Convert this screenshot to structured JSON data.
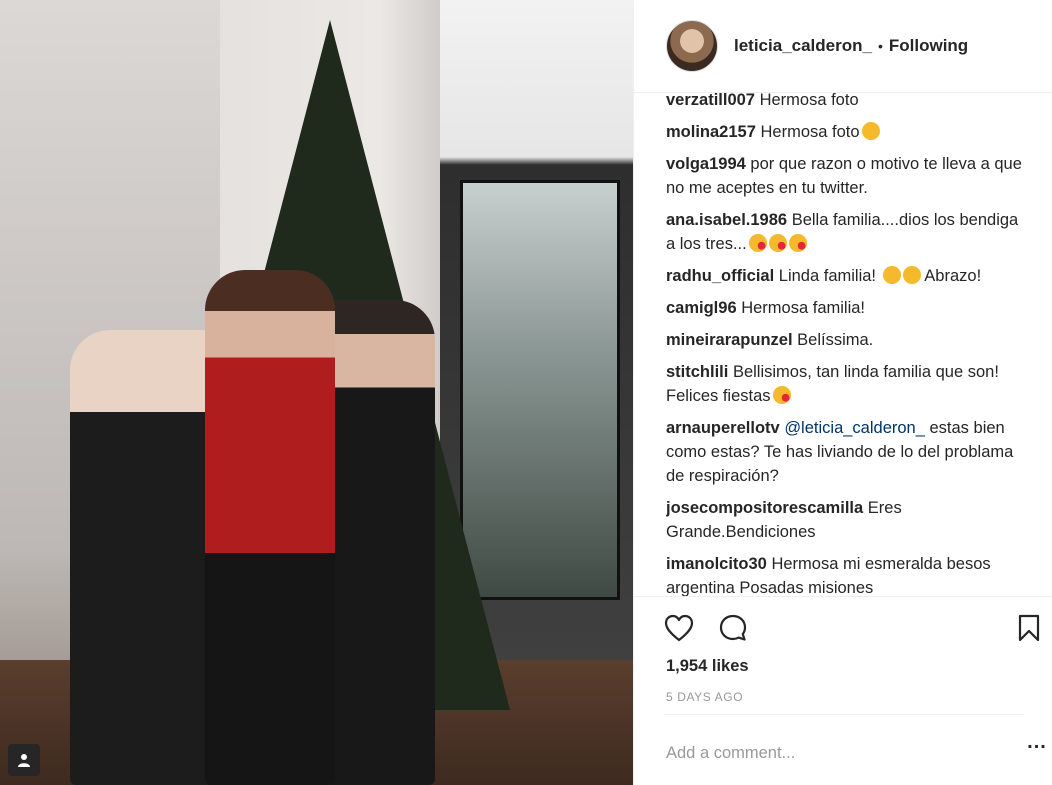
{
  "header": {
    "username": "leticia_calderon_",
    "separator": "•",
    "follow_status": "Following"
  },
  "comments": [
    {
      "user": "verzatill007",
      "text": "Hermosa foto"
    },
    {
      "user": "molina2157",
      "text": "Hermosa foto",
      "emoji": "heart-eyes-cat"
    },
    {
      "user": "volga1994",
      "text": "por que razon o motivo te lleva a que no me aceptes en tu twitter."
    },
    {
      "user": "ana.isabel.1986",
      "text": "Bella familia....dios los bendiga a los tres...",
      "emoji": "kiss-face x3"
    },
    {
      "user": "radhu_official",
      "text_before": "Linda familia!",
      "text_after": "Abrazo!",
      "emoji": "blush x2"
    },
    {
      "user": "camigl96",
      "text": "Hermosa familia!"
    },
    {
      "user": "mineirarapunzel",
      "text": "Belíssima."
    },
    {
      "user": "stitchlili",
      "text": "Bellisimos, tan linda familia que son! Felices fiestas",
      "emoji": "kiss-face"
    },
    {
      "user": "arnauperellotv",
      "mention": "@leticia_calderon_",
      "text": "estas bien como estas? Te has liviando de lo del problama de respiración?"
    },
    {
      "user": "josecompositorescamilla",
      "text": "Eres Grande.Bendiciones"
    },
    {
      "user": "imanolcito30",
      "text": "Hermosa mi esmeralda besos argentina Posadas misiones"
    }
  ],
  "actions": {
    "like_icon": "heart-icon",
    "comment_icon": "speech-bubble-icon",
    "save_icon": "bookmark-icon"
  },
  "likes": "1,954 likes",
  "date": "5 DAYS AGO",
  "add_comment": {
    "placeholder": "Add a comment...",
    "more_label": "..."
  },
  "photo": {
    "tag_icon": "user-tag-icon"
  }
}
